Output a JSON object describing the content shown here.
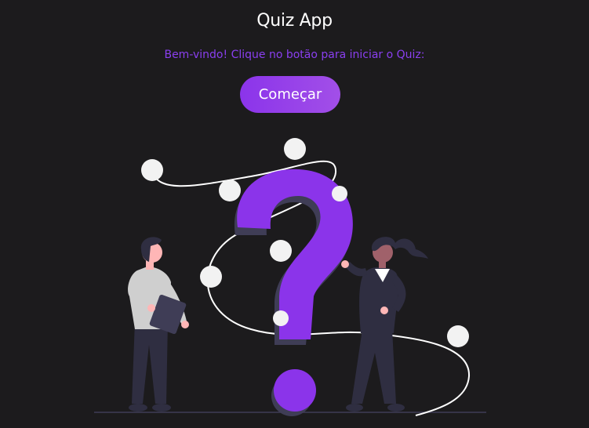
{
  "app": {
    "title": "Quiz App",
    "welcome_text": "Bem-vindo! Clique no botão para iniciar o Quiz:",
    "start_button_label": "Começar"
  },
  "colors": {
    "background": "#1c1b1d",
    "accent": "#8b34ea",
    "accent_text": "#8a3ff0",
    "dark_navy": "#2f2e41",
    "skin": "#ffb6b6",
    "dot": "#f2f2f2"
  },
  "illustration": {
    "icon": "question-mark-people-illustration"
  }
}
